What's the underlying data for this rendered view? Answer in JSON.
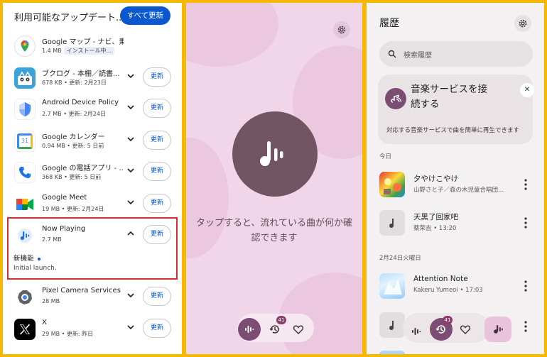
{
  "updates": {
    "title": "利用可能なアップデート...",
    "update_all_label": "すべて更新",
    "update_label": "更新",
    "apps": [
      {
        "name": "Google マップ - ナビ、乗換案内",
        "size": "1.4 MB",
        "status": "インストール中...",
        "icon": "google-maps-icon"
      },
      {
        "name": "ブクログ - 本棚／読書...",
        "meta": "678 KB • 更新: 2月23日",
        "icon": "booklog-icon"
      },
      {
        "name": "Android Device Policy",
        "meta": "2.7 MB • 更新: 2月24日",
        "icon": "device-policy-icon"
      },
      {
        "name": "Google カレンダー",
        "meta": "0.94 MB • 更新: 5 日前",
        "icon": "calendar-icon"
      },
      {
        "name": "Google の電話アプリ - ...",
        "meta": "368 KB • 更新: 5 日前",
        "icon": "phone-icon"
      },
      {
        "name": "Google Meet",
        "meta": "19 MB • 更新: 2月24日",
        "icon": "meet-icon"
      },
      {
        "name": "Now Playing",
        "meta": "2.7 MB",
        "icon": "now-playing-icon"
      },
      {
        "name": "Pixel Camera Services",
        "meta": "28 MB",
        "icon": "camera-services-icon"
      },
      {
        "name": "X",
        "meta": "29 MB • 更新: 昨日",
        "icon": "x-icon"
      }
    ],
    "calendar_day": "31",
    "now_playing_expanded": {
      "whats_new_label": "新機能",
      "notes": "Initial launch."
    }
  },
  "now_playing": {
    "message": "タップすると、流れている曲が何か確認できます",
    "history_badge": "41",
    "colors": {
      "accent": "#7c4d72",
      "circle": "#735463",
      "background": "#f1d6ea"
    }
  },
  "history": {
    "title": "履歴",
    "search_placeholder": "検索履歴",
    "connect_card": {
      "title": "音楽サービスを接続する",
      "subtitle": "対応する音楽サービスで曲を簡単に再生できます"
    },
    "sections": [
      {
        "label": "今日",
        "songs": [
          {
            "title": "夕やけこやけ",
            "artist": "山野さと子／森の木児童合唱団..."
          },
          {
            "title": "天黑了回家吧",
            "artist": "蔡荣吉 • 13:20"
          }
        ]
      },
      {
        "label": "2月24日火曜日",
        "songs": [
          {
            "title": "Attention Note",
            "artist": "Kakeru Yumeoi • 17:03"
          }
        ]
      }
    ],
    "history_badge": "41"
  }
}
